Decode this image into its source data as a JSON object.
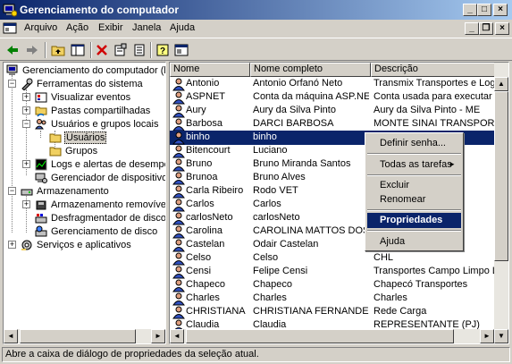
{
  "window": {
    "title": "Gerenciamento do computador"
  },
  "menu": [
    "Arquivo",
    "Ação",
    "Exibir",
    "Janela",
    "Ajuda"
  ],
  "toolbar_icons": [
    "back-icon",
    "forward-icon",
    "up-folder-icon",
    "show-tree-icon",
    "delete-icon",
    "properties-icon",
    "export-list-icon",
    "help-icon",
    "console-icon"
  ],
  "tree": [
    {
      "label": "Gerenciamento do computador (loca",
      "icon": "computer-icon"
    },
    {
      "label": "Ferramentas do sistema",
      "icon": "tools-icon"
    },
    {
      "label": "Visualizar eventos",
      "icon": "event-viewer-icon"
    },
    {
      "label": "Pastas compartilhadas",
      "icon": "shared-folder-icon"
    },
    {
      "label": "Usuários e grupos locais",
      "icon": "users-groups-icon"
    },
    {
      "label": "Usuários",
      "icon": "folder-icon"
    },
    {
      "label": "Grupos",
      "icon": "folder-icon"
    },
    {
      "label": "Logs e alertas de desempen",
      "icon": "performance-icon"
    },
    {
      "label": "Gerenciador de dispositivos",
      "icon": "device-manager-icon"
    },
    {
      "label": "Armazenamento",
      "icon": "storage-icon"
    },
    {
      "label": "Armazenamento removível",
      "icon": "removable-storage-icon"
    },
    {
      "label": "Desfragmentador de disco",
      "icon": "defrag-icon"
    },
    {
      "label": "Gerenciamento de disco",
      "icon": "disk-management-icon"
    },
    {
      "label": "Serviços e aplicativos",
      "icon": "services-icon"
    }
  ],
  "columns": [
    "Nome",
    "Nome completo",
    "Descrição"
  ],
  "rows": [
    [
      "Antonio",
      "Antonio Orfanó Neto",
      "Transmix Transportes e Logístic"
    ],
    [
      "ASPNET",
      "Conta da máquina ASP.NET",
      "Conta usada para executar o pr"
    ],
    [
      "Aury",
      "Aury da Silva Pinto",
      "Aury da Silva Pinto - ME"
    ],
    [
      "Barbosa",
      "DARCI BARBOSA",
      "MONTE SINAI TRANSPORTES E"
    ],
    [
      "binho",
      "binho",
      ""
    ],
    [
      "Bitencourt",
      "Luciano",
      ""
    ],
    [
      "Bruno",
      "Bruno Miranda Santos",
      "os de Inf"
    ],
    [
      "Brunoa",
      "Bruno Alves",
      "ess LTD"
    ],
    [
      "Carla Ribeiro",
      "Rodo VET",
      "DO IMPO"
    ],
    [
      "Carlos",
      "Carlos",
      ""
    ],
    [
      "carlosNeto",
      "carlosNeto",
      ""
    ],
    [
      "Carolina",
      "CAROLINA MATTOS DOS ...",
      "E LOGIS"
    ],
    [
      "Castelan",
      "Odair Castelan",
      "LTDA"
    ],
    [
      "Celso",
      "Celso",
      "CHL"
    ],
    [
      "Censi",
      "Felipe Censi",
      "Transportes Campo Limpo Ltda"
    ],
    [
      "Chapeco",
      "Chapeco",
      "Chapecó Transportes"
    ],
    [
      "Charles",
      "Charles",
      "Charles"
    ],
    [
      "CHRISTIANA",
      "CHRISTIANA FERNANDES...",
      "Rede Carga"
    ],
    [
      "Claudia",
      "Claudia",
      "REPRESENTANTE (PJ)"
    ]
  ],
  "context_menu": {
    "items": [
      "Definir senha...",
      "Todas as tarefas",
      "Excluir",
      "Renomear",
      "Propriedades",
      "Ajuda"
    ]
  },
  "status": "Abre a caixa de diálogo de propriedades da seleção atual."
}
